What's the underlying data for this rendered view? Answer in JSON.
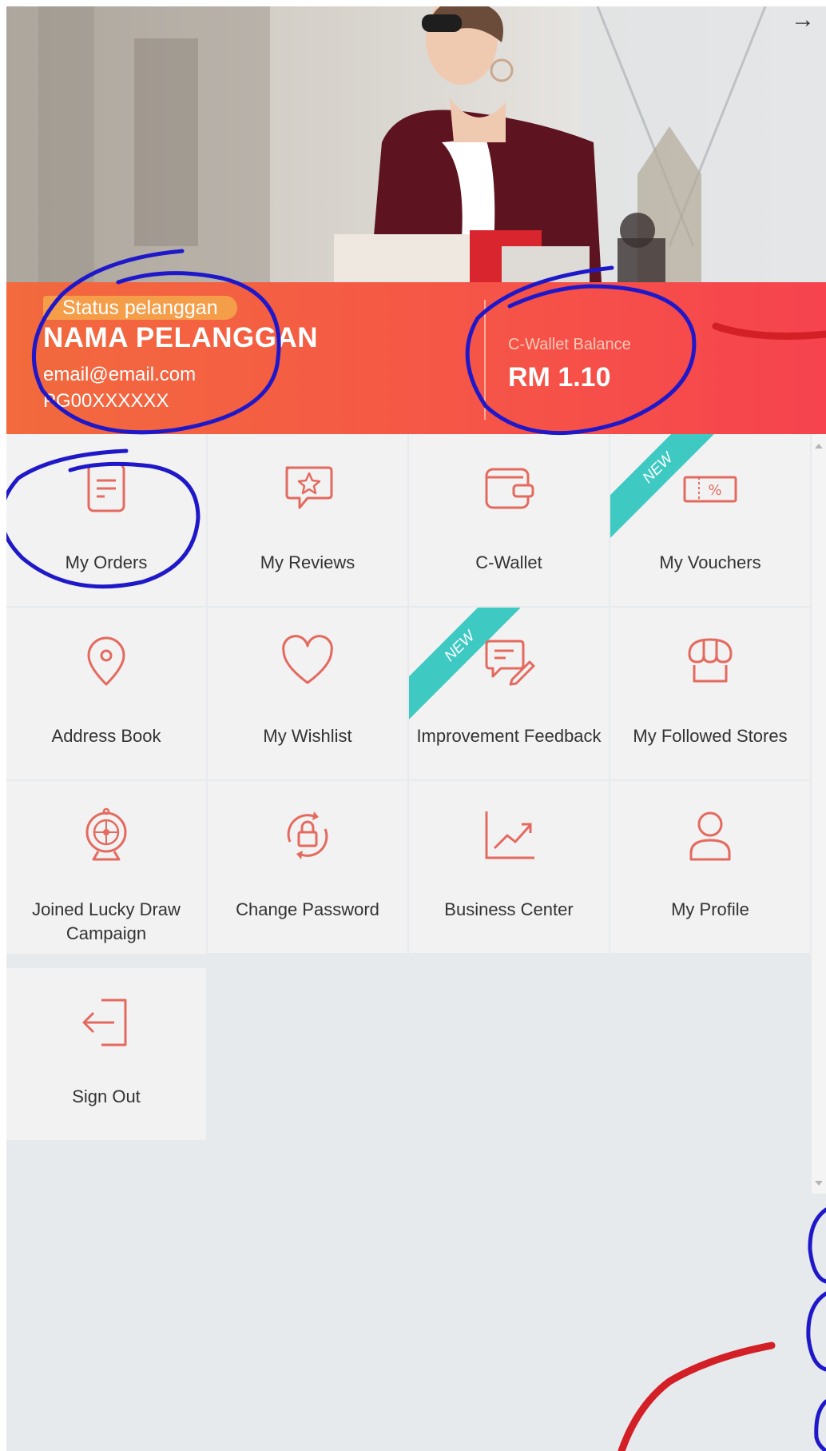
{
  "header": {
    "back_icon": "→"
  },
  "profile": {
    "status": "Status pelanggan",
    "name": "NAMA PELANGGAN",
    "email": "email@email.com",
    "id": "PG00XXXXXX",
    "wallet_label": "C-Wallet Balance",
    "wallet_amount": "RM 1.10"
  },
  "menu": [
    {
      "label": "My Orders",
      "icon": "document-icon"
    },
    {
      "label": "My Reviews",
      "icon": "review-star-icon"
    },
    {
      "label": "C-Wallet",
      "icon": "wallet-icon"
    },
    {
      "label": "My Vouchers",
      "icon": "voucher-icon",
      "badge": "NEW"
    },
    {
      "label": "Address Book",
      "icon": "location-pin-icon"
    },
    {
      "label": "My Wishlist",
      "icon": "heart-icon"
    },
    {
      "label": "Improvement Feedback",
      "icon": "feedback-icon",
      "badge": "NEW"
    },
    {
      "label": "My Followed Stores",
      "icon": "store-icon"
    },
    {
      "label": "Joined Lucky Draw Campaign",
      "icon": "lucky-wheel-icon"
    },
    {
      "label": "Change Password",
      "icon": "lock-refresh-icon"
    },
    {
      "label": "Business Center",
      "icon": "chart-icon"
    },
    {
      "label": "My Profile",
      "icon": "user-icon"
    },
    {
      "label": "Sign Out",
      "icon": "sign-out-icon"
    }
  ],
  "colors": {
    "accent": "#e46a5f",
    "banner_start": "#f26a3d",
    "banner_end": "#f6434e",
    "ribbon": "#3ec9c3",
    "annotation_blue": "#1f18c9",
    "annotation_red": "#d31f26"
  }
}
